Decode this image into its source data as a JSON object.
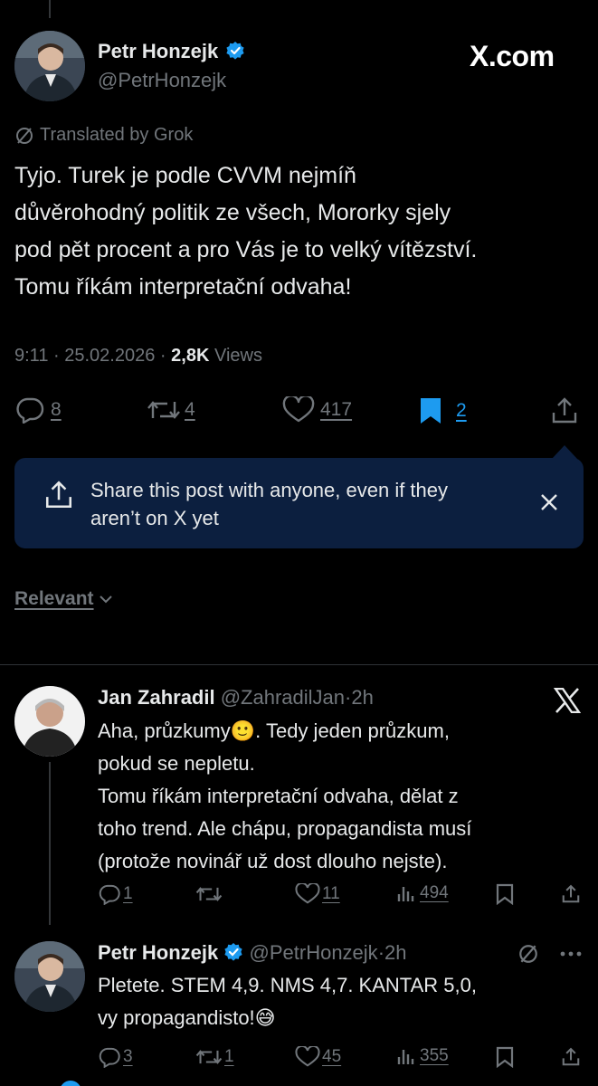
{
  "main_post": {
    "author_name": "Petr Honzejk",
    "author_handle": "@PetrHonzejk",
    "site_logo": "X.com",
    "translation_note": "Translated by Grok",
    "text_lines": [
      "Tyjo. Turek je podle CVVM nejmíň",
      "důvěrohodný politik ze všech, Mororky sjely",
      "pod pět procent a pro Vás je to velký vítězství.",
      "Tomu říkám interpretační odvaha!"
    ],
    "time": "9:11",
    "date": "25.02.2026",
    "separator": "·",
    "views_count": "2,8K",
    "views_label": "Views",
    "replies": "8",
    "reposts": "4",
    "likes": "417",
    "bookmarks": "2"
  },
  "share_banner": {
    "line1": "Share this post with anyone, even if they",
    "line2": "aren’t on X yet"
  },
  "sort": {
    "label": "Relevant"
  },
  "replies": [
    {
      "author_name": "Jan Zahradil",
      "author_handle": "@ZahradilJan",
      "time": "2h",
      "line1_prefix": "Aha, průzkumy",
      "line1_emoji": "🙂",
      "line1_suffix": ". Tedy jeden průzkum,",
      "lines": [
        "pokud se nepletu.",
        "Tomu říkám interpretační odvaha, dělat z",
        "toho trend. Ale chápu, propagandista musí",
        "(protože novinář už dost dlouho nejste)."
      ],
      "replies": "1",
      "reposts": "",
      "likes": "11",
      "views": "494"
    },
    {
      "author_name": "Petr Honzejk",
      "author_handle": "@PetrHonzejk",
      "time": "2h",
      "line1": "Pletete. STEM 4,9. NMS 4,7. KANTAR 5,0,",
      "line2_text": "vy propagandisto!",
      "line2_emoji": "😅",
      "replies": "3",
      "reposts": "1",
      "likes": "45",
      "views": "355"
    }
  ],
  "colors": {
    "background": "#000000",
    "text": "#e7e9ea",
    "muted": "#71767b",
    "accent": "#1d9bf0",
    "banner": "#0c1f3f"
  }
}
